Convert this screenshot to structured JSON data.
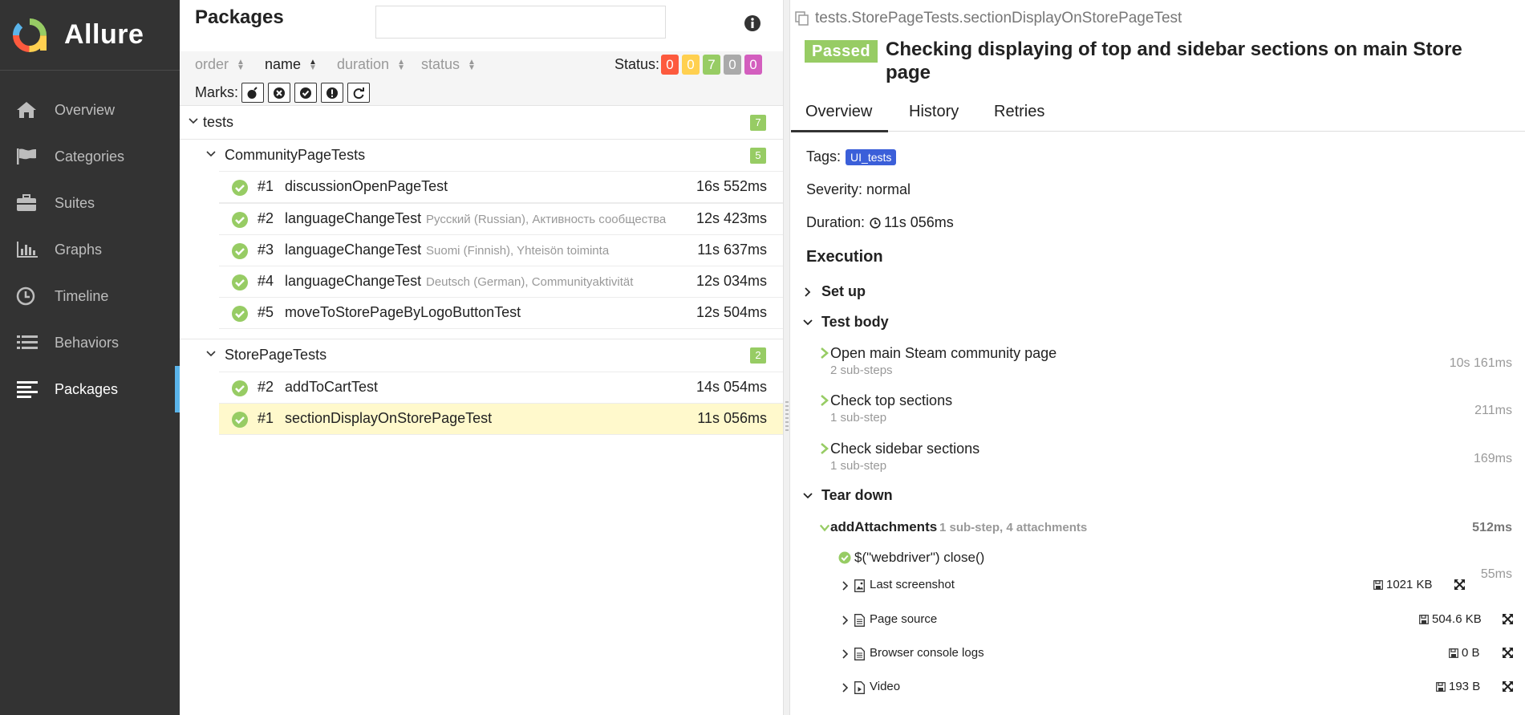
{
  "brand": {
    "name": "Allure"
  },
  "sidebar": {
    "items": [
      {
        "label": "Overview",
        "icon": "home-icon"
      },
      {
        "label": "Categories",
        "icon": "flag-icon"
      },
      {
        "label": "Suites",
        "icon": "briefcase-icon"
      },
      {
        "label": "Graphs",
        "icon": "bar-chart-icon"
      },
      {
        "label": "Timeline",
        "icon": "clock-icon"
      },
      {
        "label": "Behaviors",
        "icon": "list-icon"
      },
      {
        "label": "Packages",
        "icon": "align-left-icon",
        "active": true
      }
    ]
  },
  "packages": {
    "title": "Packages",
    "search_value": "",
    "sort": {
      "order": "order",
      "name": "name",
      "duration": "duration",
      "status": "status"
    },
    "status_label": "Status:",
    "status_counts": [
      {
        "value": "0",
        "color": "#fd5a3e"
      },
      {
        "value": "0",
        "color": "#ffd050"
      },
      {
        "value": "7",
        "color": "#97cc64"
      },
      {
        "value": "0",
        "color": "#aaaaaa"
      },
      {
        "value": "0",
        "color": "#d35ebe"
      }
    ],
    "marks_label": "Marks:",
    "marks": [
      "bomb-icon",
      "times-circle-icon",
      "check-circle-icon",
      "exclamation-circle-icon",
      "refresh-icon"
    ],
    "tree": {
      "root": {
        "name": "tests",
        "count": "7"
      },
      "groups": [
        {
          "name": "CommunityPageTests",
          "count": "5",
          "items": [
            {
              "num": "#1",
              "name": "discussionOpenPageTest",
              "params": "",
              "duration": "16s 552ms"
            },
            {
              "num": "#2",
              "name": "languageChangeTest",
              "params": "Русский (Russian), Активность сообщества",
              "duration": "12s 423ms"
            },
            {
              "num": "#3",
              "name": "languageChangeTest",
              "params": "Suomi (Finnish), Yhteisön toiminta",
              "duration": "11s 637ms"
            },
            {
              "num": "#4",
              "name": "languageChangeTest",
              "params": "Deutsch (German), Communityaktivität",
              "duration": "12s 034ms"
            },
            {
              "num": "#5",
              "name": "moveToStorePageByLogoButtonTest",
              "params": "",
              "duration": "12s 504ms"
            }
          ]
        },
        {
          "name": "StorePageTests",
          "count": "2",
          "items": [
            {
              "num": "#2",
              "name": "addToCartTest",
              "params": "",
              "duration": "14s 054ms"
            },
            {
              "num": "#1",
              "name": "sectionDisplayOnStorePageTest",
              "params": "",
              "duration": "11s 056ms",
              "selected": true
            }
          ]
        }
      ]
    }
  },
  "testcase": {
    "path": "tests.StorePageTests.sectionDisplayOnStorePageTest",
    "status": "Passed",
    "title": "Checking displaying of top and sidebar sections on main Store page",
    "tabs": [
      "Overview",
      "History",
      "Retries"
    ],
    "tags_label": "Tags:",
    "tag": "UI_tests",
    "severity": "Severity: normal",
    "duration_label": "Duration:",
    "duration": "11s 056ms",
    "execution_title": "Execution",
    "setup_label": "Set up",
    "body_label": "Test body",
    "steps": [
      {
        "name": "Open main Steam community page",
        "sub": "2 sub-steps",
        "duration": "10s 161ms"
      },
      {
        "name": "Check top sections",
        "sub": "1 sub-step",
        "duration": "211ms"
      },
      {
        "name": "Check sidebar sections",
        "sub": "1 sub-step",
        "duration": "169ms"
      }
    ],
    "teardown_label": "Tear down",
    "teardown": {
      "name": "addAttachments",
      "info": "1 sub-step, 4 attachments",
      "duration": "512ms",
      "substep": {
        "name": "$(\"webdriver\") close()",
        "duration": "55ms"
      },
      "attachments": [
        {
          "name": "Last screenshot",
          "size": "1021 KB",
          "icon": "image-file-icon"
        },
        {
          "name": "Page source",
          "size": "504.6 KB",
          "icon": "text-file-icon"
        },
        {
          "name": "Browser console logs",
          "size": "0 B",
          "icon": "text-file-icon"
        },
        {
          "name": "Video",
          "size": "193 B",
          "icon": "video-file-icon"
        }
      ]
    }
  }
}
